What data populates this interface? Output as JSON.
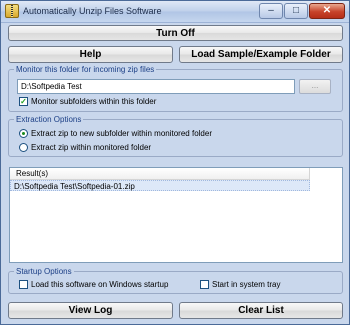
{
  "window": {
    "title": "Automatically Unzip Files Software"
  },
  "title_buttons": {
    "minimize": "–",
    "maximize": "□",
    "close": "✕"
  },
  "buttons": {
    "turn_off": "Turn Off",
    "help": "Help",
    "load_sample": "Load Sample/Example Folder",
    "view_log": "View Log",
    "clear_list": "Clear List"
  },
  "monitor": {
    "legend": "Monitor this folder for incoming zip files",
    "folder_value": "D:\\Softpedia Test",
    "browse_label": "...",
    "subfolders_label": "Monitor subfolders within this folder",
    "subfolders_checked": true
  },
  "extraction": {
    "legend": "Extraction Options",
    "options": [
      {
        "label": "Extract zip to new subfolder within monitored folder",
        "selected": true
      },
      {
        "label": "Extract zip within monitored folder",
        "selected": false
      }
    ]
  },
  "results": {
    "header": "Result(s)",
    "rows": [
      "D:\\Softpedia Test\\Softpedia-01.zip"
    ]
  },
  "startup": {
    "legend": "Startup Options",
    "load_on_startup_label": "Load this software on Windows startup",
    "load_on_startup_checked": false,
    "tray_label": "Start in system tray",
    "tray_checked": false
  },
  "colors": {
    "window_bg": "#c9d7ec",
    "group_legend": "#1c3f86",
    "selected_row": "#dde8f8"
  }
}
